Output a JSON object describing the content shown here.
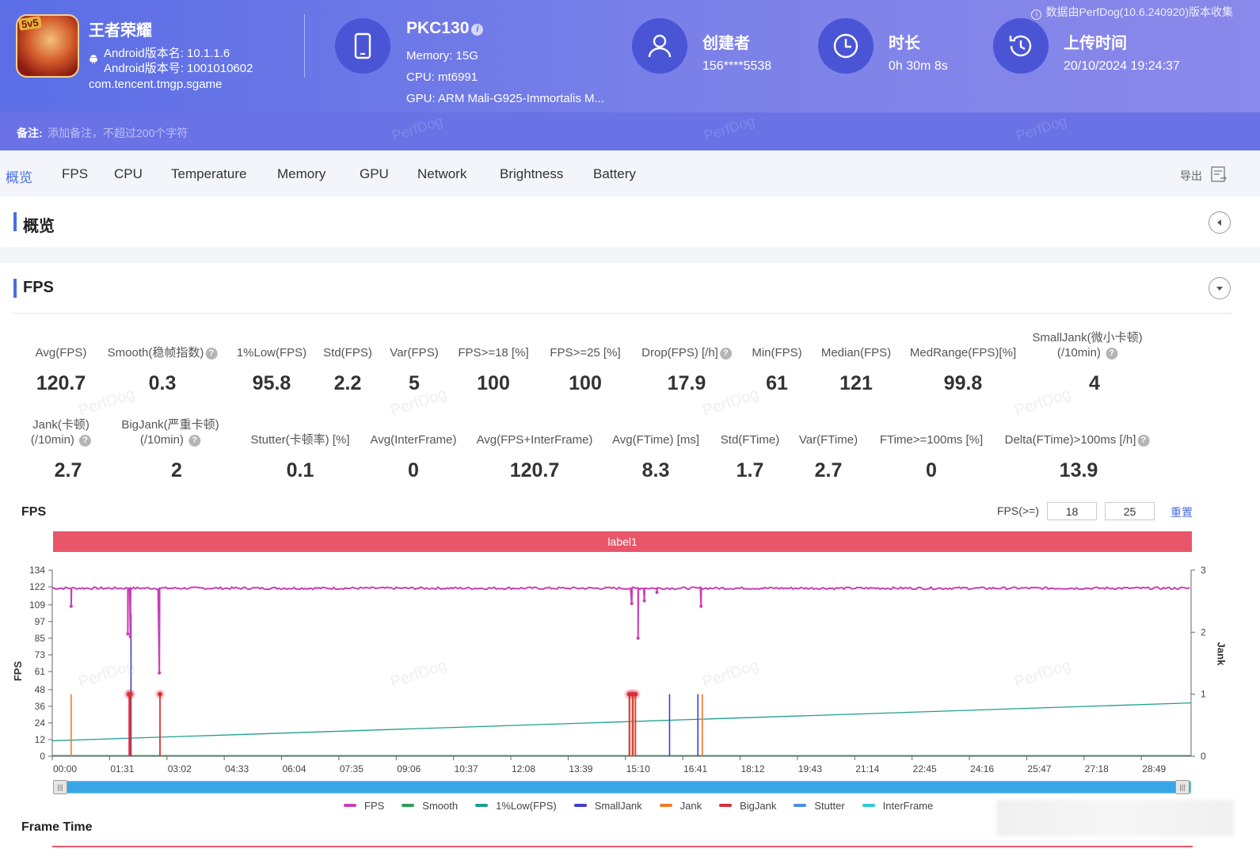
{
  "header": {
    "notice": "数据由PerfDog(10.6.240920)版本收集",
    "app": {
      "badge": "5v5",
      "name": "王者荣耀",
      "version_name": "Android版本名: 10.1.1.6",
      "version_code": "Android版本号: 1001010602",
      "package": "com.tencent.tmgp.sgame"
    },
    "device": {
      "name": "PKC130",
      "memory": "Memory: 15G",
      "cpu": "CPU: mt6991",
      "gpu": "GPU: ARM Mali-G925-Immortalis M..."
    },
    "creator": {
      "label": "创建者",
      "value": "156****5538"
    },
    "duration": {
      "label": "时长",
      "value": "0h 30m 8s"
    },
    "upload": {
      "label": "上传时间",
      "value": "20/10/2024 19:24:37"
    },
    "remark": {
      "label": "备注:",
      "placeholder": "添加备注，不超过200个字符"
    },
    "watermark": "PerfDog"
  },
  "tabs": [
    "概览",
    "FPS",
    "CPU",
    "Temperature",
    "Memory",
    "GPU",
    "Network",
    "Brightness",
    "Battery"
  ],
  "export_label": "导出",
  "sections": {
    "overview": "概览",
    "fps": "FPS"
  },
  "metrics_row1": [
    {
      "label": "Avg(FPS)",
      "value": "120.7"
    },
    {
      "label": "Smooth(稳帧指数)",
      "value": "0.3"
    },
    {
      "label": "1%Low(FPS)",
      "value": "95.8"
    },
    {
      "label": "Std(FPS)",
      "value": "2.2"
    },
    {
      "label": "Var(FPS)",
      "value": "5"
    },
    {
      "label": "FPS>=18 [%]",
      "value": "100"
    },
    {
      "label": "FPS>=25 [%]",
      "value": "100"
    },
    {
      "label": "Drop(FPS) [/h]",
      "value": "17.9"
    },
    {
      "label": "Min(FPS)",
      "value": "61"
    },
    {
      "label": "Median(FPS)",
      "value": "121"
    },
    {
      "label": "MedRange(FPS)[%]",
      "value": "99.8"
    },
    {
      "label": "SmallJank(微小卡顿)",
      "label2": "(/10min)",
      "value": "4"
    }
  ],
  "metrics_row2": [
    {
      "label": "Jank(卡顿)",
      "label2": "(/10min)",
      "value": "2.7"
    },
    {
      "label": "BigJank(严重卡顿)",
      "label2": "(/10min)",
      "value": "2"
    },
    {
      "label": "Stutter(卡顿率) [%]",
      "value": "0.1"
    },
    {
      "label": "Avg(InterFrame)",
      "value": "0"
    },
    {
      "label": "Avg(FPS+InterFrame)",
      "value": "120.7"
    },
    {
      "label": "Avg(FTime) [ms]",
      "value": "8.3"
    },
    {
      "label": "Std(FTime)",
      "value": "1.7"
    },
    {
      "label": "Var(FTime)",
      "value": "2.7"
    },
    {
      "label": "FTime>=100ms [%]",
      "value": "0"
    },
    {
      "label": "Delta(FTime)>100ms [/h]",
      "value": "13.9"
    }
  ],
  "chart_panel": {
    "title": "FPS",
    "filter_label": "FPS(>=)",
    "filter_values": [
      "18",
      "25"
    ],
    "reset": "重置",
    "band_label": "label1",
    "y_left_label": "FPS",
    "y_right_label": "Jank",
    "frame_time_title": "Frame Time"
  },
  "colors": {
    "fps": "#c93fb5",
    "smooth": "#2ca05a",
    "low1": "#1f9e8f",
    "smalljank": "#4040d0",
    "jank": "#ee7a2a",
    "bigjank": "#d9303a",
    "stutter": "#4a8fe0",
    "interframe": "#2fc7d6"
  },
  "chart_data": {
    "type": "line",
    "x_ticks": [
      "00:00",
      "01:31",
      "03:02",
      "04:33",
      "06:04",
      "07:35",
      "09:06",
      "10:37",
      "12:08",
      "13:39",
      "15:10",
      "16:41",
      "18:12",
      "19:43",
      "21:14",
      "22:45",
      "24:16",
      "25:47",
      "27:18",
      "28:49"
    ],
    "y_left_ticks": [
      0,
      12,
      24,
      36,
      48,
      61,
      73,
      85,
      97,
      109,
      122,
      134
    ],
    "y_right_ticks": [
      0,
      1,
      2,
      3
    ],
    "y_left_label": "FPS",
    "y_right_label": "Jank",
    "ylim_left": [
      0,
      134
    ],
    "ylim_right": [
      0,
      3
    ],
    "xlim_seconds": [
      0,
      1808
    ],
    "series": [
      {
        "name": "FPS",
        "baseline": 121,
        "dips": [
          [
            30,
            108
          ],
          [
            120,
            88
          ],
          [
            122,
            121
          ],
          [
            124,
            86
          ],
          [
            170,
            60
          ],
          [
            172,
            121
          ],
          [
            920,
            110
          ],
          [
            925,
            121
          ],
          [
            930,
            85
          ],
          [
            935,
            121
          ],
          [
            940,
            112
          ],
          [
            960,
            118
          ],
          [
            1030,
            108
          ]
        ]
      },
      {
        "name": "Smooth",
        "values": []
      },
      {
        "name": "1%Low(FPS)",
        "values": [
          [
            0,
            0.25
          ],
          [
            1808,
            0.86
          ]
        ]
      },
      {
        "name": "SmallJank",
        "spikes": [
          [
            125,
            2.3
          ],
          [
            980,
            1
          ],
          [
            1025,
            1
          ]
        ]
      },
      {
        "name": "Jank",
        "spikes": [
          [
            30,
            1
          ],
          [
            123,
            1
          ],
          [
            171,
            1
          ],
          [
            917,
            1
          ],
          [
            923,
            1
          ],
          [
            1032,
            1
          ]
        ]
      },
      {
        "name": "BigJank",
        "spikes": [
          [
            122,
            1
          ],
          [
            124,
            1
          ],
          [
            171,
            1
          ],
          [
            916,
            1
          ],
          [
            921,
            1
          ],
          [
            926,
            1
          ]
        ]
      },
      {
        "name": "Stutter",
        "values": []
      },
      {
        "name": "InterFrame",
        "values": []
      }
    ],
    "legend": [
      "FPS",
      "Smooth",
      "1%Low(FPS)",
      "SmallJank",
      "Jank",
      "BigJank",
      "Stutter",
      "InterFrame"
    ]
  }
}
